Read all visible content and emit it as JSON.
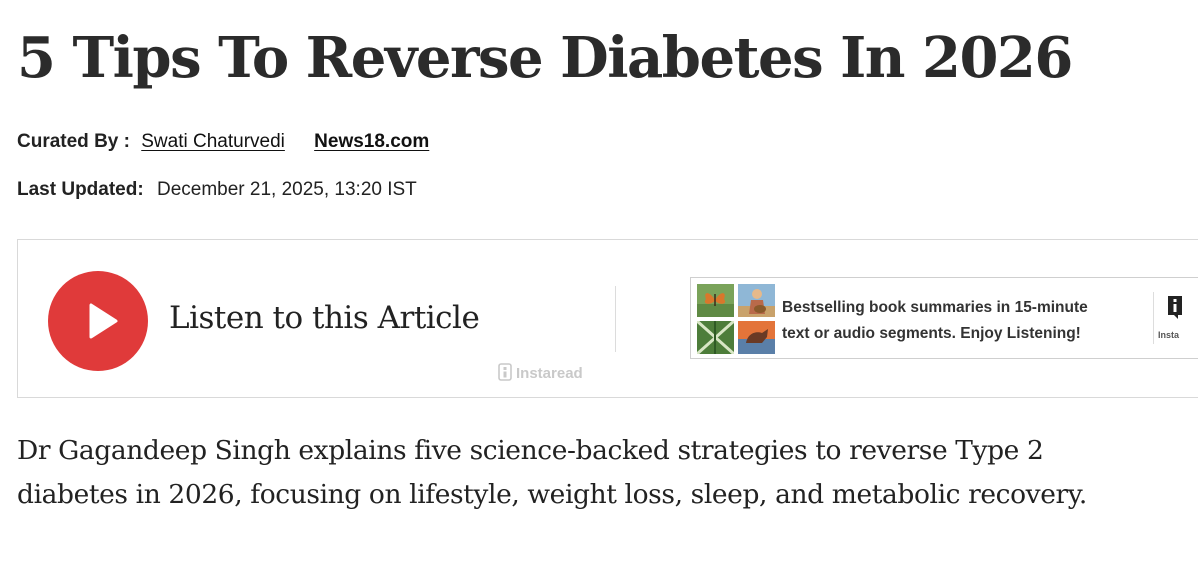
{
  "article": {
    "title": "5 Tips To Reverse Diabetes In 2026",
    "byline": {
      "label": "Curated By :",
      "author": "Swati Chaturvedi",
      "source": "News18.com"
    },
    "updated": {
      "label": "Last Updated:",
      "value": "December 21, 2025, 13:20 IST"
    },
    "summary": "Dr Gagandeep Singh explains five science-backed strategies to reverse Type 2 diabetes in 2026, focusing on lifestyle, weight loss, sleep, and metabolic recovery."
  },
  "audio_player": {
    "listen_label": "Listen to this Article",
    "brand": "Instaread",
    "play_icon": "play-icon",
    "play_color": "#e03a3a"
  },
  "ad": {
    "line1": "Bestselling book summaries in 15-minute",
    "line2": "text or audio segments. Enjoy Listening!",
    "logo_text": "Insta"
  }
}
